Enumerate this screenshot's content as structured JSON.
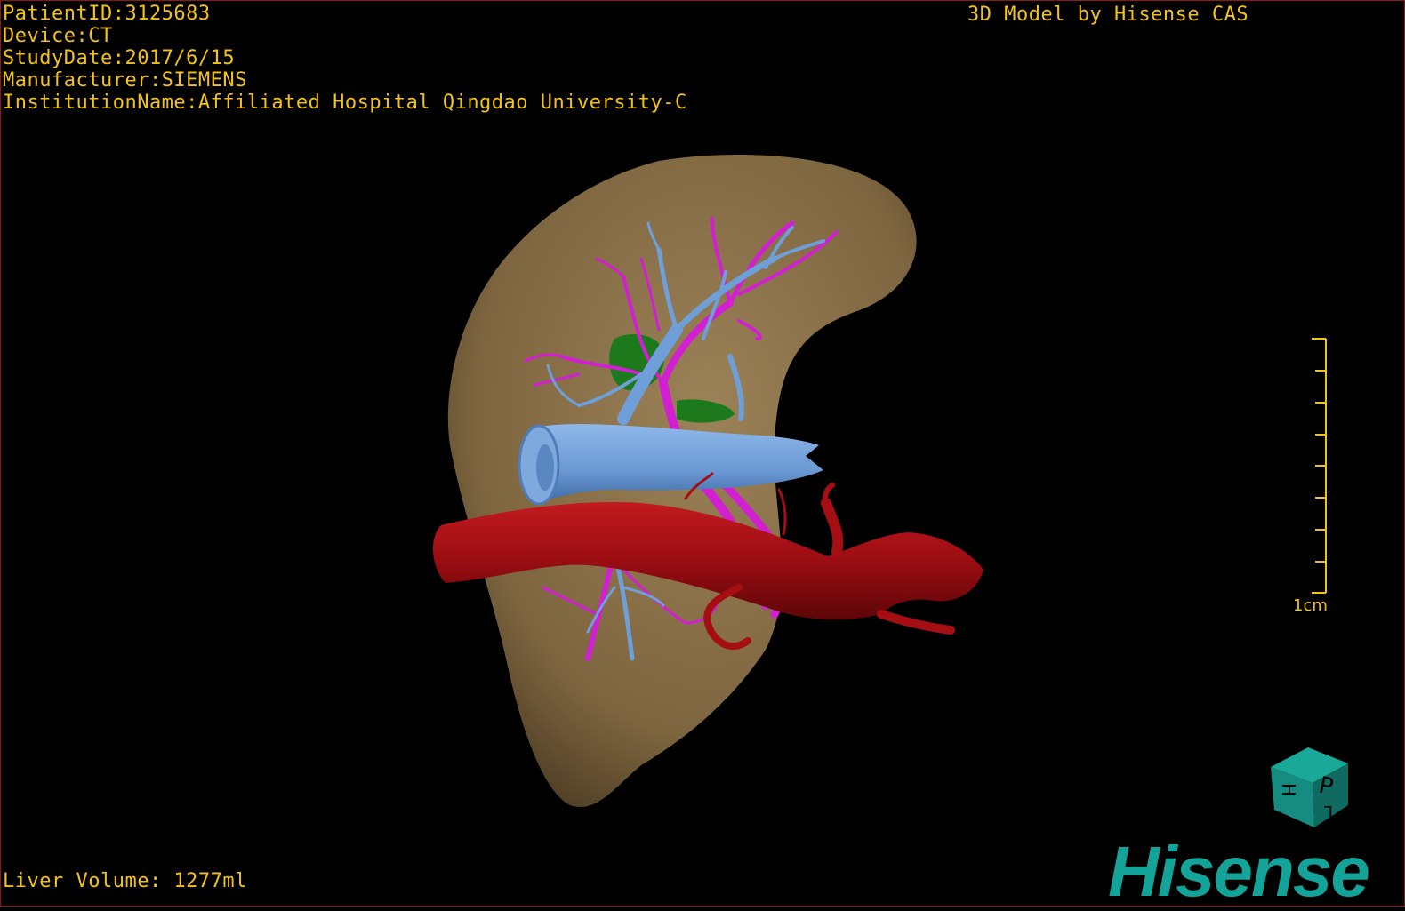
{
  "info": {
    "patient_id": "PatientID:3125683",
    "device": "Device:CT",
    "study_date": "StudyDate:2017/6/15",
    "manufacturer": "Manufacturer:SIEMENS",
    "institution": "InstitutionName:Affiliated Hospital Qingdao University-C"
  },
  "credit": "3D Model by Hisense CAS",
  "volume": "Liver Volume: 1277ml",
  "scale": {
    "label": "1cm",
    "ticks": 9
  },
  "orientation_cube": {
    "faces": [
      "P",
      "H",
      "L"
    ]
  },
  "logo": "Hisense",
  "colors": {
    "overlay_text": "#f2c21a",
    "liver": "#8f7650",
    "portal_vein": "#6f9fd8",
    "hepatic_vein": "#d21fd2",
    "artery": "#a50f14",
    "gallbladder": "#1c7a1c",
    "brand": "#14a398"
  }
}
